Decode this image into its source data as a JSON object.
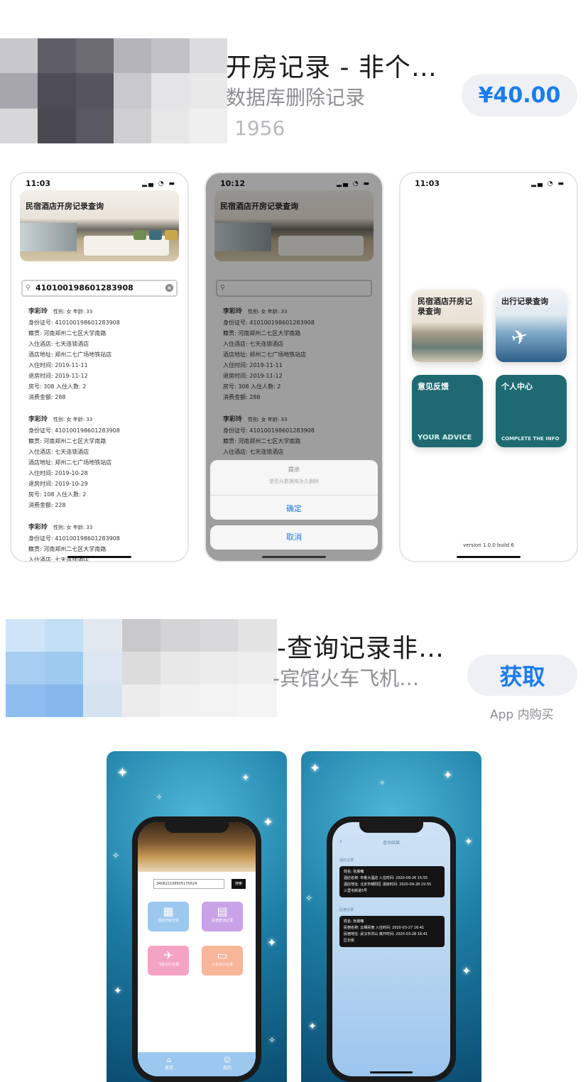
{
  "app1": {
    "title": "开房记录 - 非个…",
    "subtitle": "数据库删除记录",
    "rating_count": "1956",
    "price": "¥40.00",
    "screenshot1": {
      "time": "11:03",
      "banner": "民宿酒店开房记录查询",
      "search_value": "410100198601283908",
      "records": [
        {
          "name": "李彩玲",
          "meta": "性别: 女  年龄: 33",
          "lines": [
            "身份证号: 410100198601283908",
            "籍贯: 河南郑州二七区大学南路",
            "入住酒店: 七天连锁酒店",
            "酒店地址: 郑州二七广场地铁站店",
            "入住时间: 2019-11-11",
            "退房时间: 2019-11-12",
            "房号: 308   入住人数: 2",
            "消费金额: 288"
          ]
        },
        {
          "name": "李彩玲",
          "meta": "性别: 女  年龄: 33",
          "lines": [
            "身份证号: 410100198601283908",
            "籍贯: 河南郑州二七区大学南路",
            "入住酒店: 七天连锁酒店",
            "酒店地址: 郑州二七广场地铁站店",
            "入住时间: 2019-10-28",
            "退房时间: 2019-10-29",
            "房号: 108   入住人数: 2",
            "消费金额: 228"
          ]
        },
        {
          "name": "李彩玲",
          "meta": "性别: 女  年龄: 33",
          "lines": [
            "身份证号: 410100198601283908",
            "籍贯: 河南郑州二七区大学南路",
            "入住酒店: 七天连锁酒店"
          ]
        }
      ]
    },
    "screenshot2": {
      "time": "10:12",
      "banner": "民宿酒店开房记录查询",
      "alert_title": "提示",
      "alert_message": "是否从数据库永久删除",
      "confirm_label": "确定",
      "cancel_label": "取消"
    },
    "screenshot3": {
      "time": "11:03",
      "tiles": [
        {
          "title": "民宿酒店开房记录查询",
          "sub": ""
        },
        {
          "title": "出行记录查询",
          "sub": ""
        },
        {
          "title": "意见反馈",
          "sub": "YOUR ADVICE"
        },
        {
          "title": "个人中心",
          "sub": "COMPLETE THE INFO"
        }
      ],
      "version": "version 1.0.0 build 6"
    }
  },
  "app2": {
    "title": "-查询记录非…",
    "subtitle": "-宾馆火车飞机…",
    "get_label": "获取",
    "iap_note": "App 内购买",
    "screenshot1": {
      "input_value": "340822198505175624",
      "search_label": "搜索",
      "tiles": [
        "酒店开房记录",
        "民宿查询记录",
        "飞机出行记录",
        "火车出行记录"
      ],
      "tab_labels": [
        "首页",
        "我的"
      ]
    },
    "screenshot2": {
      "header": "查询结果",
      "section1": "酒店记录",
      "card1": [
        "姓名: 张晨曦",
        "酒店名称: 布鲁大酒店   入住时间: 2020-09-26 15:55",
        "酒店地址: 北京市朝阳区   退房时间: 2020-09-28 15:55",
        "三里屯街道5号"
      ],
      "section2": "民宿记录",
      "card2": [
        "姓名: 张晨曦",
        "民宿名称: 云栖民宿   入住时间: 2020-03-27 16:41",
        "民宿地址: 武汉市洪山   离开时间: 2020-03-28 16:41",
        "区长街"
      ]
    }
  },
  "colors": {
    "accent": "#1a7cf0",
    "teal_tile": "#1f6a72",
    "pill_bg": "#eef0f4"
  }
}
